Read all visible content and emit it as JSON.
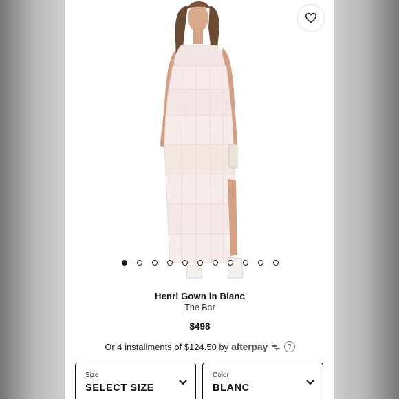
{
  "product": {
    "title": "Henri Gown in Blanc",
    "brand": "The Bar",
    "price": "$498"
  },
  "installments": {
    "text": "Or 4 installments of $124.50 by",
    "provider": "afterpay"
  },
  "carousel": {
    "total_dots": 11,
    "active_index": 0
  },
  "selects": {
    "size": {
      "label": "Size",
      "value": "SELECT SIZE"
    },
    "color": {
      "label": "Color",
      "value": "BLANC"
    }
  },
  "icons": [
    "heart-icon",
    "afterpay-logo",
    "help-icon",
    "chevron-down-icon"
  ]
}
